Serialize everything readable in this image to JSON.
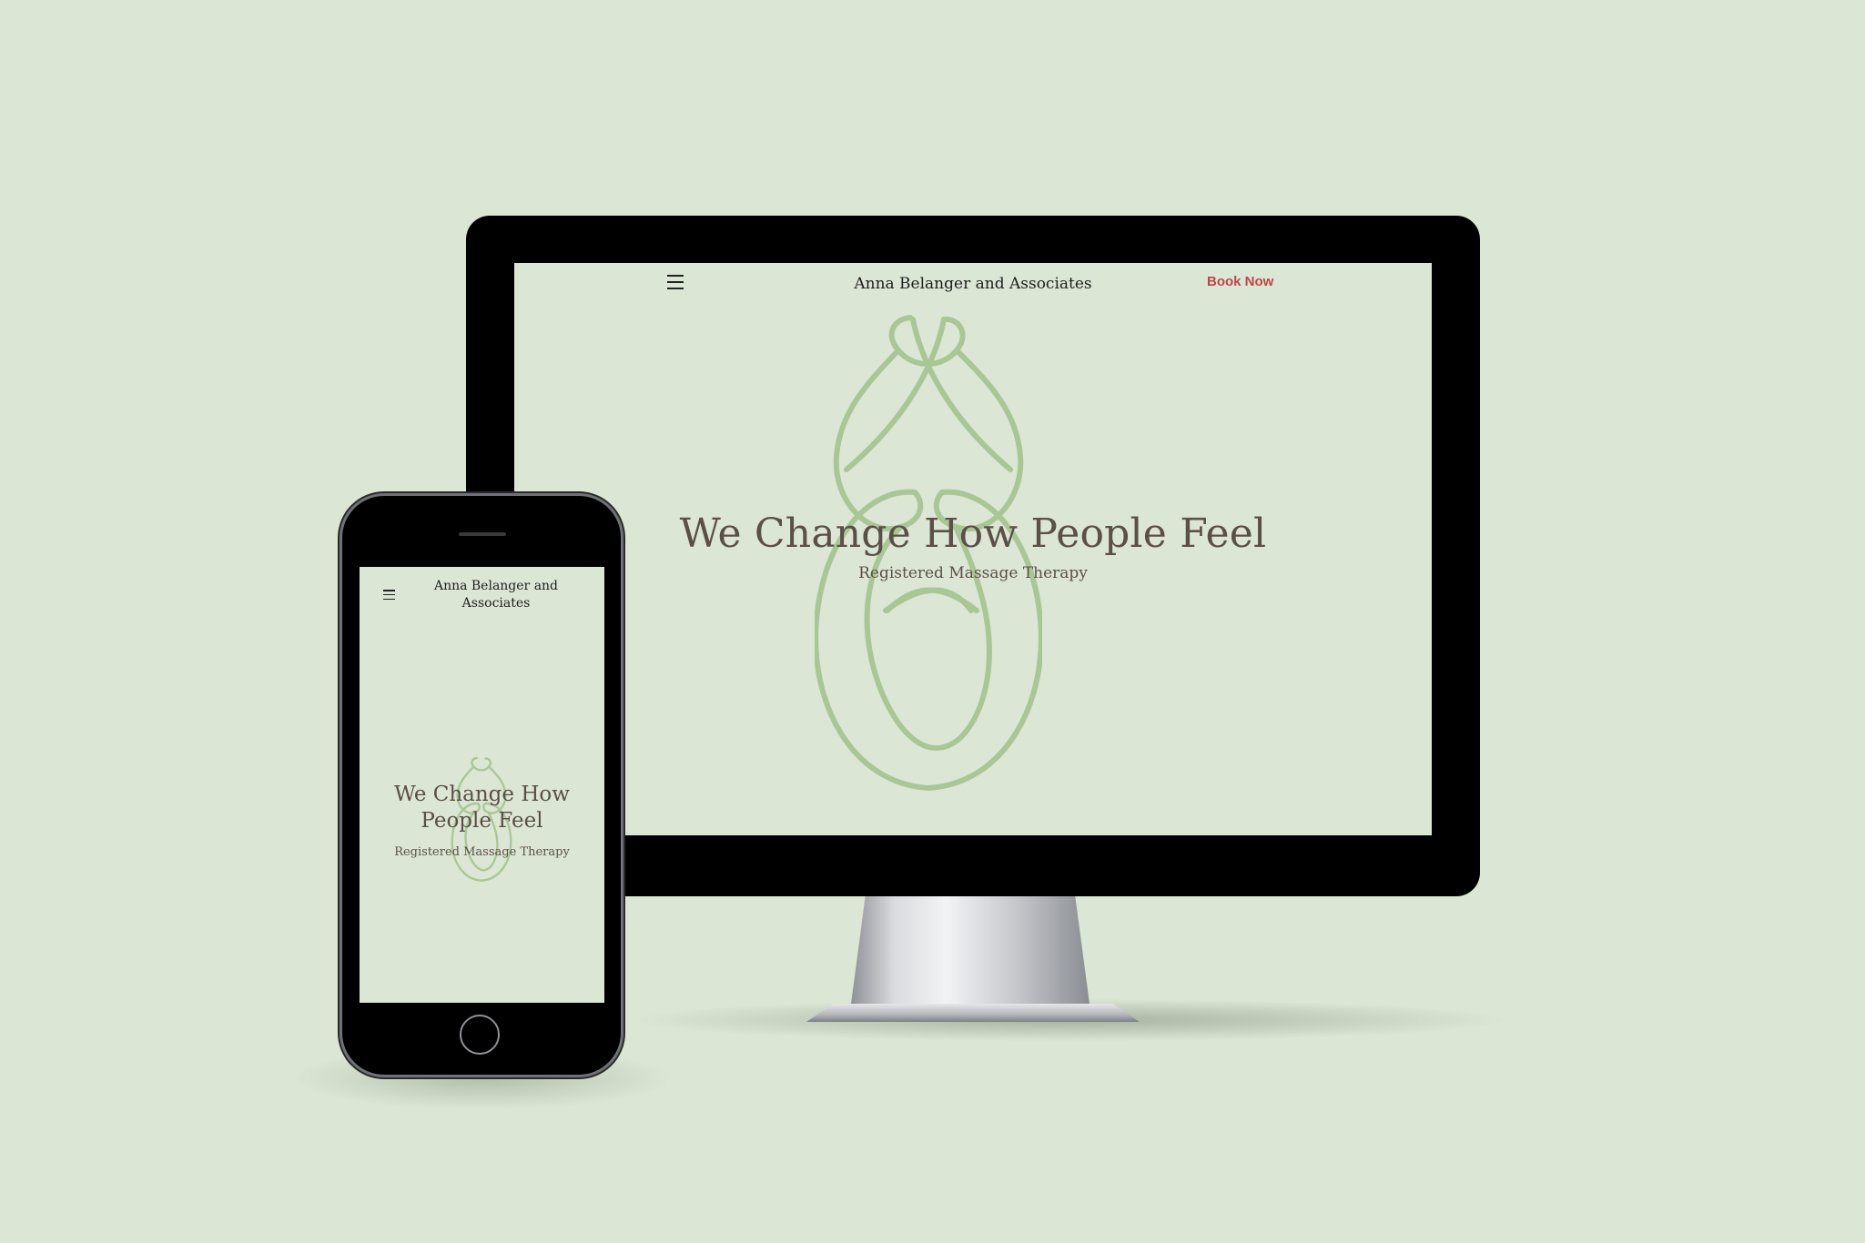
{
  "brand_name": "Anna Belanger and Associates",
  "nav": {
    "book_label": "Book Now"
  },
  "hero": {
    "title": "We Change How People Feel",
    "mobile_title_line1": "We Change How",
    "mobile_title_line2": "People Feel",
    "subtitle": "Registered Massage Therapy"
  },
  "icons": {
    "menu": "hamburger-menu-icon",
    "logo": "knot-figure-logo"
  },
  "colors": {
    "background": "#dce6d4",
    "logo_stroke": "#a9c795",
    "book_now": "#c0454a",
    "heading": "#5b4f48"
  }
}
